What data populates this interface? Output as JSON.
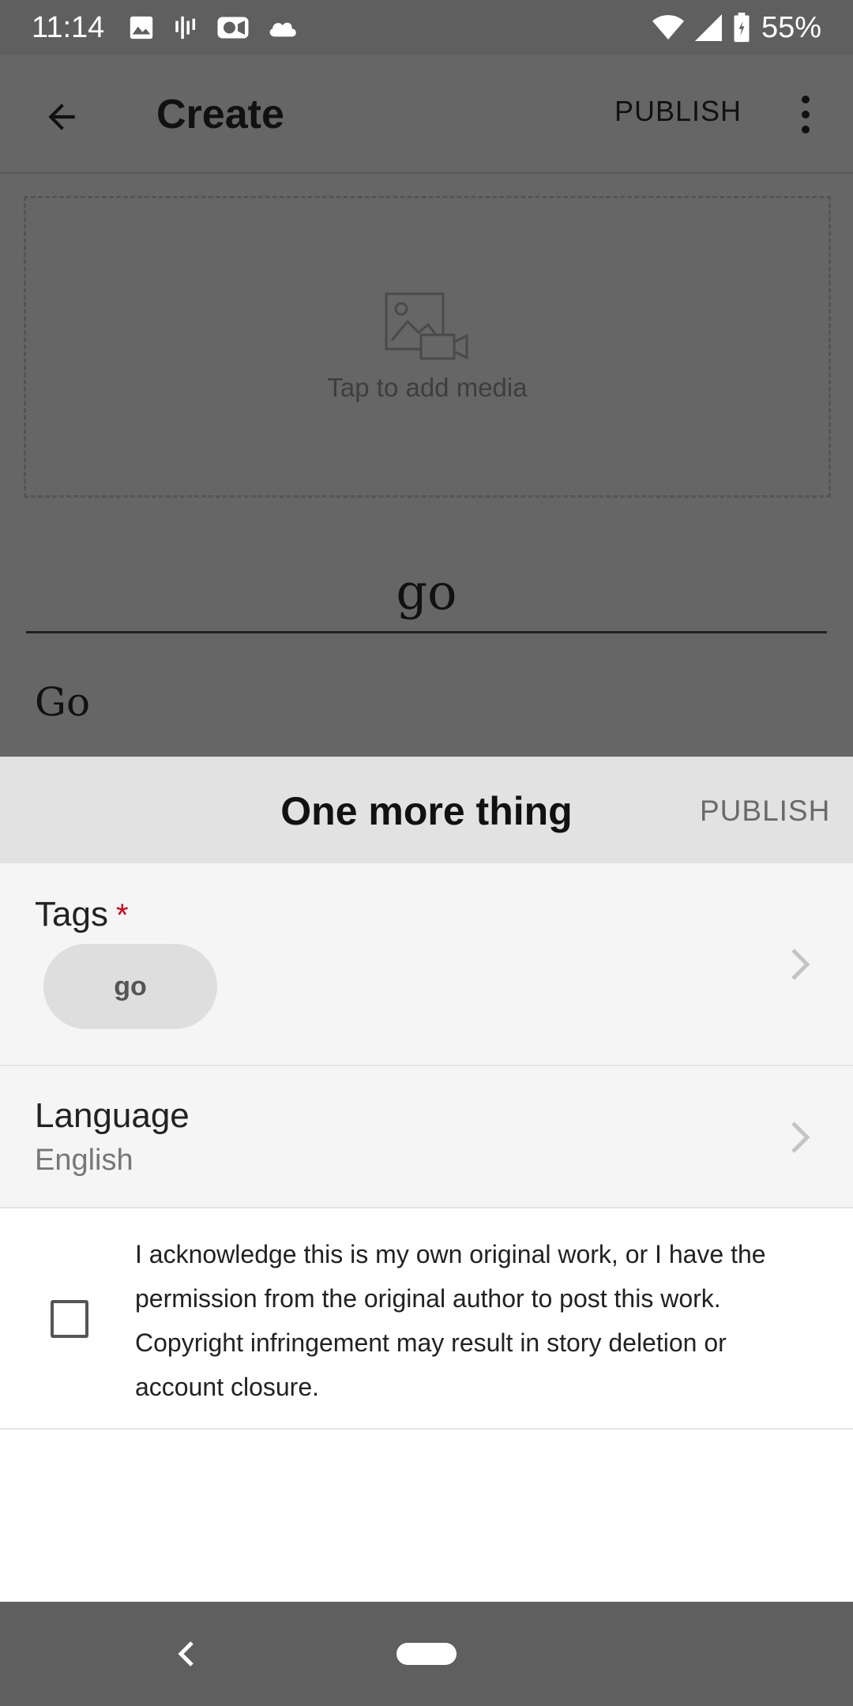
{
  "status_bar": {
    "time": "11:14",
    "battery_percent": "55%",
    "left_icons": [
      "image-icon",
      "voicemail-bars-icon",
      "video-camera-icon",
      "cloud-icon"
    ],
    "right_icons": [
      "wifi-icon",
      "cell-signal-icon",
      "battery-icon"
    ]
  },
  "app_bar": {
    "title": "Create",
    "publish_label": "PUBLISH",
    "back_icon": "arrow-back-icon",
    "more_icon": "more-vert-icon"
  },
  "editor": {
    "media_placeholder": "Tap to add media",
    "story_title": "go",
    "story_body": "Go"
  },
  "sheet": {
    "title": "One more thing",
    "publish_label": "PUBLISH",
    "tags": {
      "label": "Tags",
      "required_mark": "*",
      "chips": [
        "go"
      ]
    },
    "language": {
      "label": "Language",
      "value": "English"
    },
    "acknowledgement": {
      "checked": false,
      "text": "I acknowledge this is my own original work, or I have the permission from the original author to post this work. Copyright infringement may result in story deletion or account closure."
    }
  },
  "colors": {
    "dim_overlay": "#666666",
    "status_bar": "#5f5f5f",
    "sheet_header": "#e2e2e2",
    "row_background": "#f5f5f5",
    "required": "#d0021b"
  }
}
